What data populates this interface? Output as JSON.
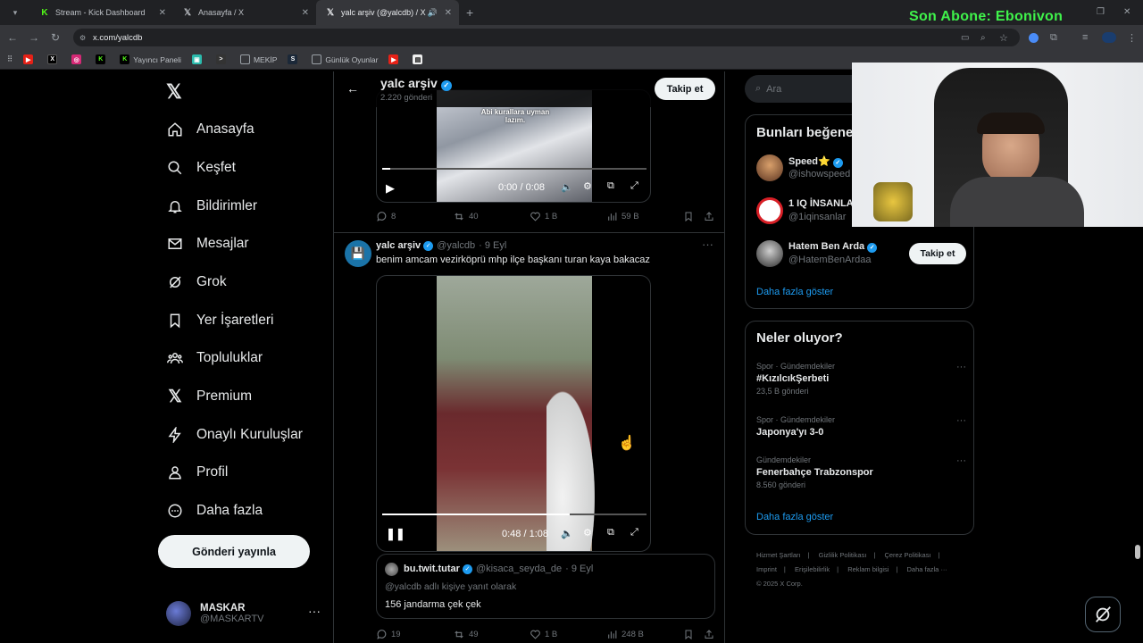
{
  "browser": {
    "tabs": [
      {
        "title": "Stream - Kick Dashboard",
        "fav": "K",
        "color": "#53fc18"
      },
      {
        "title": "Anasayfa / X",
        "fav": "X",
        "color": "#ffffff"
      },
      {
        "title": "yalc arşiv (@yalcdb) / X",
        "fav": "X",
        "color": "#ffffff"
      }
    ],
    "url": "x.com/yalcdb",
    "bookmarks": [
      "Yayıncı Paneli",
      "MEKİP",
      "Günlük Oyunlar"
    ]
  },
  "overlay": {
    "text": "Son Abone: Ebonivon"
  },
  "nav": {
    "items": [
      "Anasayfa",
      "Keşfet",
      "Bildirimler",
      "Mesajlar",
      "Grok",
      "Yer İşaretleri",
      "Topluluklar",
      "Premium",
      "Onaylı Kuruluşlar",
      "Profil",
      "Daha fazla"
    ],
    "post_button": "Gönderi yayınla",
    "account_name": "MASKAR",
    "account_handle": "@MASKARTV"
  },
  "header": {
    "name": "yalc arşiv",
    "count": "2.220 gönderi",
    "follow": "Takip et"
  },
  "post1": {
    "caption": "Abi kurallara uyman lazım.",
    "time": "0:00 / 0:08",
    "replies": "8",
    "reposts": "40",
    "likes": "1 B",
    "views": "59 B"
  },
  "post2": {
    "name": "yalc arşiv",
    "handle": "@yalcdb",
    "date": "· 9 Eyl",
    "text": "benim amcam vezirköprü mhp ilçe başkanı turan kaya bakacaz",
    "time": "0:48 / 1:08",
    "progress": 0.71,
    "quote_name": "bu.twit.tutar",
    "quote_handle": "@kisaca_seyda_de",
    "quote_date": "· 9 Eyl",
    "quote_reply": "@yalcdb adlı kişiye yanıt olarak",
    "quote_text": "156 jandarma çek çek",
    "replies": "19",
    "reposts": "49",
    "likes": "1 B",
    "views": "248 B"
  },
  "right": {
    "search_placeholder": "Ara",
    "who_title": "Bunları beğene",
    "who": [
      {
        "name": "Speed⭐",
        "handle": "@ishowspeed"
      },
      {
        "name": "1 IQ İNSANLA",
        "handle": "@1iqinsanlar"
      },
      {
        "name": "Hatem Ben Arda",
        "handle": "@HatemBenArdaa",
        "follow": "Takip et"
      }
    ],
    "show_more": "Daha fazla göster",
    "trends_title": "Neler oluyor?",
    "trends": [
      {
        "cat": "Spor · Gündemdekiler",
        "topic": "#KızılcıkŞerbeti",
        "count": "23,5 B gönderi"
      },
      {
        "cat": "Spor · Gündemdekiler",
        "topic": "Japonya'yı 3-0",
        "count": ""
      },
      {
        "cat": "Gündemdekiler",
        "topic": "Fenerbahçe Trabzonspor",
        "count": "8.560 gönderi"
      }
    ],
    "trends_more": "Daha fazla göster",
    "footer": [
      "Hizmet Şartları",
      "Gizlilik Politikası",
      "Çerez Politikası",
      "Imprint",
      "Erişilebilirlik",
      "Reklam bilgisi",
      "Daha fazla ···",
      "© 2025 X Corp."
    ]
  }
}
